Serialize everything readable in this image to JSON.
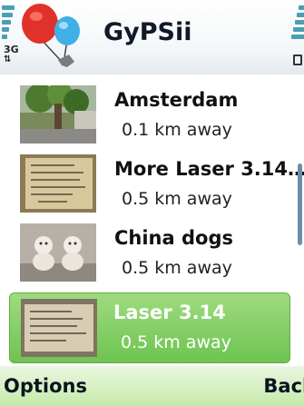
{
  "status": {
    "network": "3G"
  },
  "app": {
    "title": "GyPSii",
    "icon": "gypsii-balloons-logo"
  },
  "list": {
    "items": [
      {
        "name": "Amsterdam",
        "distance": "0.1 km away",
        "thumbnail": "tree-photo",
        "selected": false
      },
      {
        "name": "More Laser 3.14…",
        "distance": "0.5 km away",
        "thumbnail": "handwritten-note-photo",
        "selected": false
      },
      {
        "name": "China dogs",
        "distance": "0.5 km away",
        "thumbnail": "porcelain-dogs-photo",
        "selected": false
      },
      {
        "name": "Laser 3.14",
        "distance": "0.5 km away",
        "thumbnail": "handwritten-sign-photo",
        "selected": true
      }
    ]
  },
  "softkeys": {
    "left": "Options",
    "right": "Back"
  },
  "colors": {
    "selection": "#7fcd5d",
    "softkey_bar": "#d6f0c2",
    "indicator": "#4b9fb3"
  }
}
